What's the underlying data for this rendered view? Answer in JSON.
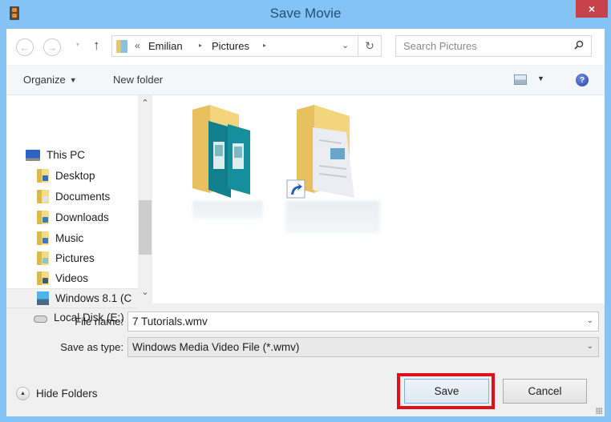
{
  "window": {
    "title": "Save Movie",
    "close_label": "×"
  },
  "navbar": {
    "back_glyph": "←",
    "forward_glyph": "→",
    "recent_glyph": "▾",
    "up_glyph": "↑",
    "address": {
      "overflow": "«",
      "crumbs": [
        "Emilian",
        "Pictures"
      ],
      "separator": "▸",
      "dropdown_glyph": "⌄"
    },
    "refresh_glyph": "↻",
    "search": {
      "placeholder": "Search Pictures",
      "value": ""
    }
  },
  "toolbar": {
    "organize_label": "Organize",
    "organize_caret": "▼",
    "new_folder_label": "New folder",
    "view_caret": "▼",
    "help_glyph": "?"
  },
  "nav_pane": {
    "scroll_up_glyph": "⌃",
    "scroll_down_glyph": "⌄",
    "items": [
      {
        "label": "This PC",
        "icon": "computer-icon"
      },
      {
        "label": "Desktop",
        "icon": "desktop-folder-icon"
      },
      {
        "label": "Documents",
        "icon": "documents-folder-icon"
      },
      {
        "label": "Downloads",
        "icon": "downloads-folder-icon"
      },
      {
        "label": "Music",
        "icon": "music-folder-icon"
      },
      {
        "label": "Pictures",
        "icon": "pictures-folder-icon"
      },
      {
        "label": "Videos",
        "icon": "videos-folder-icon"
      },
      {
        "label": "Windows 8.1 (C",
        "icon": "windows-drive-icon",
        "selected": true
      },
      {
        "label": "Local Disk (E:)",
        "icon": "hard-drive-icon"
      }
    ]
  },
  "content": {
    "folders": [
      {
        "icon": "pictures-library-folder-icon",
        "label_redacted": true,
        "shortcut": false
      },
      {
        "icon": "documents-shortcut-folder-icon",
        "label_redacted": true,
        "shortcut": true
      }
    ]
  },
  "form": {
    "file_name_label": "File name:",
    "file_name_value": "7 Tutorials.wmv",
    "save_type_label": "Save as type:",
    "save_type_value": "Windows Media Video File (*.wmv)",
    "chevron_glyph": "⌄"
  },
  "footer": {
    "hide_folders_label": "Hide Folders",
    "hide_glyph": "▲",
    "save_label": "Save",
    "cancel_label": "Cancel"
  },
  "annotation": {
    "highlight_color": "#e0101a",
    "highlighted": "save-button"
  }
}
